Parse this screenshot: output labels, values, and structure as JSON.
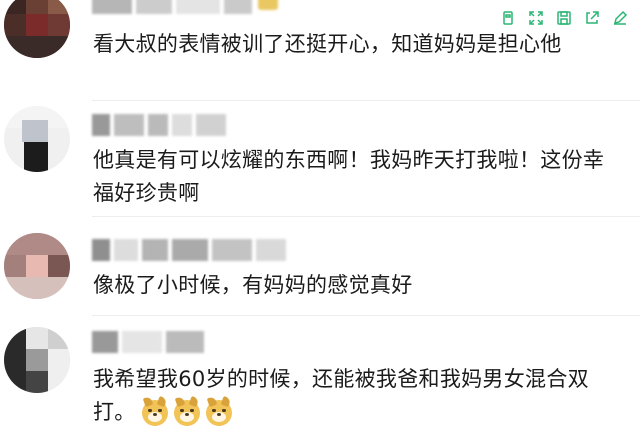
{
  "toolbar": {
    "icons": [
      "copy-icon",
      "expand-icon",
      "save-icon",
      "share-icon",
      "edit-icon"
    ],
    "accent": "#2bb673"
  },
  "comments": [
    {
      "username": "",
      "text": "看大叔的表情被训了还挺开心，知道妈妈是担心他",
      "emoji_count": 0
    },
    {
      "username": "",
      "text": "他真是有可以炫耀的东西啊！我妈昨天打我啦！这份幸福好珍贵啊",
      "emoji_count": 0
    },
    {
      "username": "",
      "text": "像极了小时候，有妈妈的感觉真好",
      "emoji_count": 0
    },
    {
      "username": "",
      "text": "我希望我60岁的时候，还能被我爸和我妈男女混合双打。",
      "emoji_count": 3,
      "emoji_name": "doge-emoji"
    }
  ]
}
